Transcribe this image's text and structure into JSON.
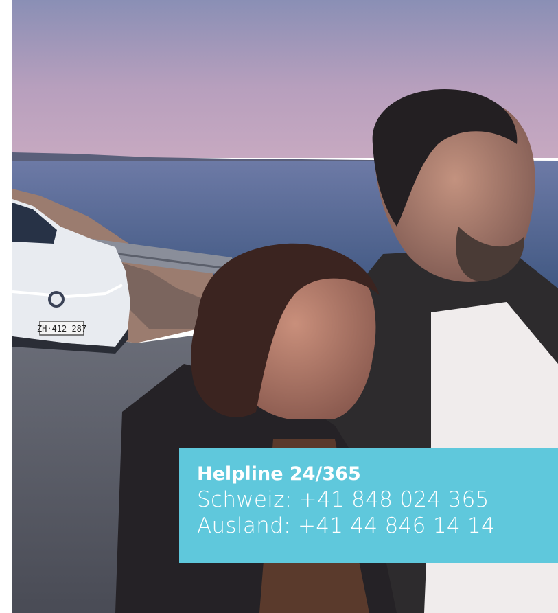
{
  "photo": {
    "subject": "couple-by-sea-with-white-car-scene",
    "license_plate": "ZH·412 287"
  },
  "helpline": {
    "title": "Helpline 24/365",
    "switzerland": "Schweiz: +41 848 024 365",
    "abroad": "Ausland: +41 44 846 14 14"
  },
  "colors": {
    "card_background": "#5fc8dc",
    "card_text": "#ffffff"
  }
}
